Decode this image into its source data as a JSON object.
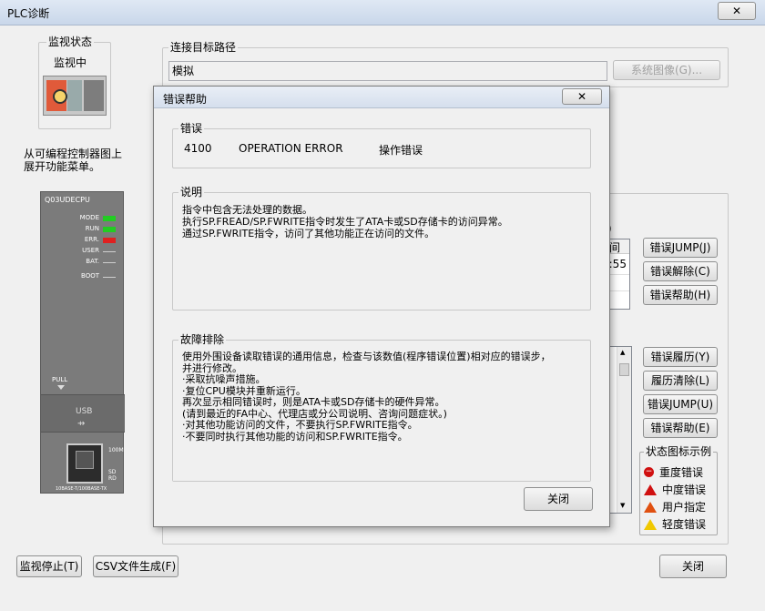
{
  "window": {
    "title": "PLC诊断",
    "close_label": "✕"
  },
  "monitor": {
    "group_title": "监视状态",
    "status": "监视中",
    "hint": "从可编程控制器图上展开功能菜单。"
  },
  "plc": {
    "model": "Q03UDECPU",
    "leds": [
      {
        "label": "MODE",
        "color": "#22cc22"
      },
      {
        "label": "RUN",
        "color": "#22cc22"
      },
      {
        "label": "ERR.",
        "color": "#e02020"
      },
      {
        "label": "USER",
        "color": ""
      },
      {
        "label": "BAT.",
        "color": ""
      },
      {
        "label": "BOOT",
        "color": ""
      }
    ],
    "pull": "PULL",
    "usb": "USB",
    "port_right_top": "100M",
    "port_right_bottom": "SD RD",
    "port_bottom": "10BASE-T/100BASE-TX"
  },
  "connection": {
    "group_title": "连接目标路径",
    "value": "模拟",
    "system_image_button": "系统图像(G)..."
  },
  "right_buttons": {
    "error_jump": "错误JUMP(J)",
    "error_clear": "错误解除(C)",
    "error_help": "错误帮助(H)",
    "error_history": "错误履历(Y)",
    "history_clear": "履历清除(L)",
    "error_jump2": "错误JUMP(U)",
    "error_help2": "错误帮助(E)"
  },
  "partial_list": {
    "header_frag": "间",
    "time_frag": "0:55",
    "paren_frag": ")"
  },
  "legend": {
    "title": "状态图标示例",
    "items": [
      {
        "icon": "major-error-icon",
        "label": "重度错误",
        "color": "#d01010"
      },
      {
        "icon": "moderate-error-icon",
        "label": "中度错误",
        "color": "#d01010"
      },
      {
        "icon": "user-specified-icon",
        "label": "用户指定",
        "color": "#e05010"
      },
      {
        "icon": "minor-error-icon",
        "label": "轻度错误",
        "color": "#f0c800"
      }
    ]
  },
  "bottom": {
    "stop_monitor": "监视停止(T)",
    "csv": "CSV文件生成(F)",
    "close": "关闭"
  },
  "dialog": {
    "title": "错误帮助",
    "close_label": "✕",
    "error_group": "错误",
    "error_code": "4100",
    "error_name": "OPERATION ERROR",
    "error_cn": "操作错误",
    "desc_group": "说明",
    "desc_lines": [
      "指令中包含无法处理的数据。",
      "执行SP.FREAD/SP.FWRITE指令时发生了ATA卡或SD存储卡的访问异常。",
      "通过SP.FWRITE指令，访问了其他功能正在访问的文件。"
    ],
    "trouble_group": "故障排除",
    "trouble_lines": [
      "使用外围设备读取错误的通用信息，检查与该数值(程序错误位置)相对应的错误步，",
      "并进行修改。",
      "·采取抗噪声措施。",
      "·复位CPU模块并重新运行。",
      "再次显示相同错误时，则是ATA卡或SD存储卡的硬件异常。",
      "(请到最近的FA中心、代理店或分公司说明、咨询问题症状。)",
      "·对其他功能访问的文件，不要执行SP.FWRITE指令。",
      "·不要同时执行其他功能的访问和SP.FWRITE指令。"
    ],
    "close_button": "关闭"
  }
}
